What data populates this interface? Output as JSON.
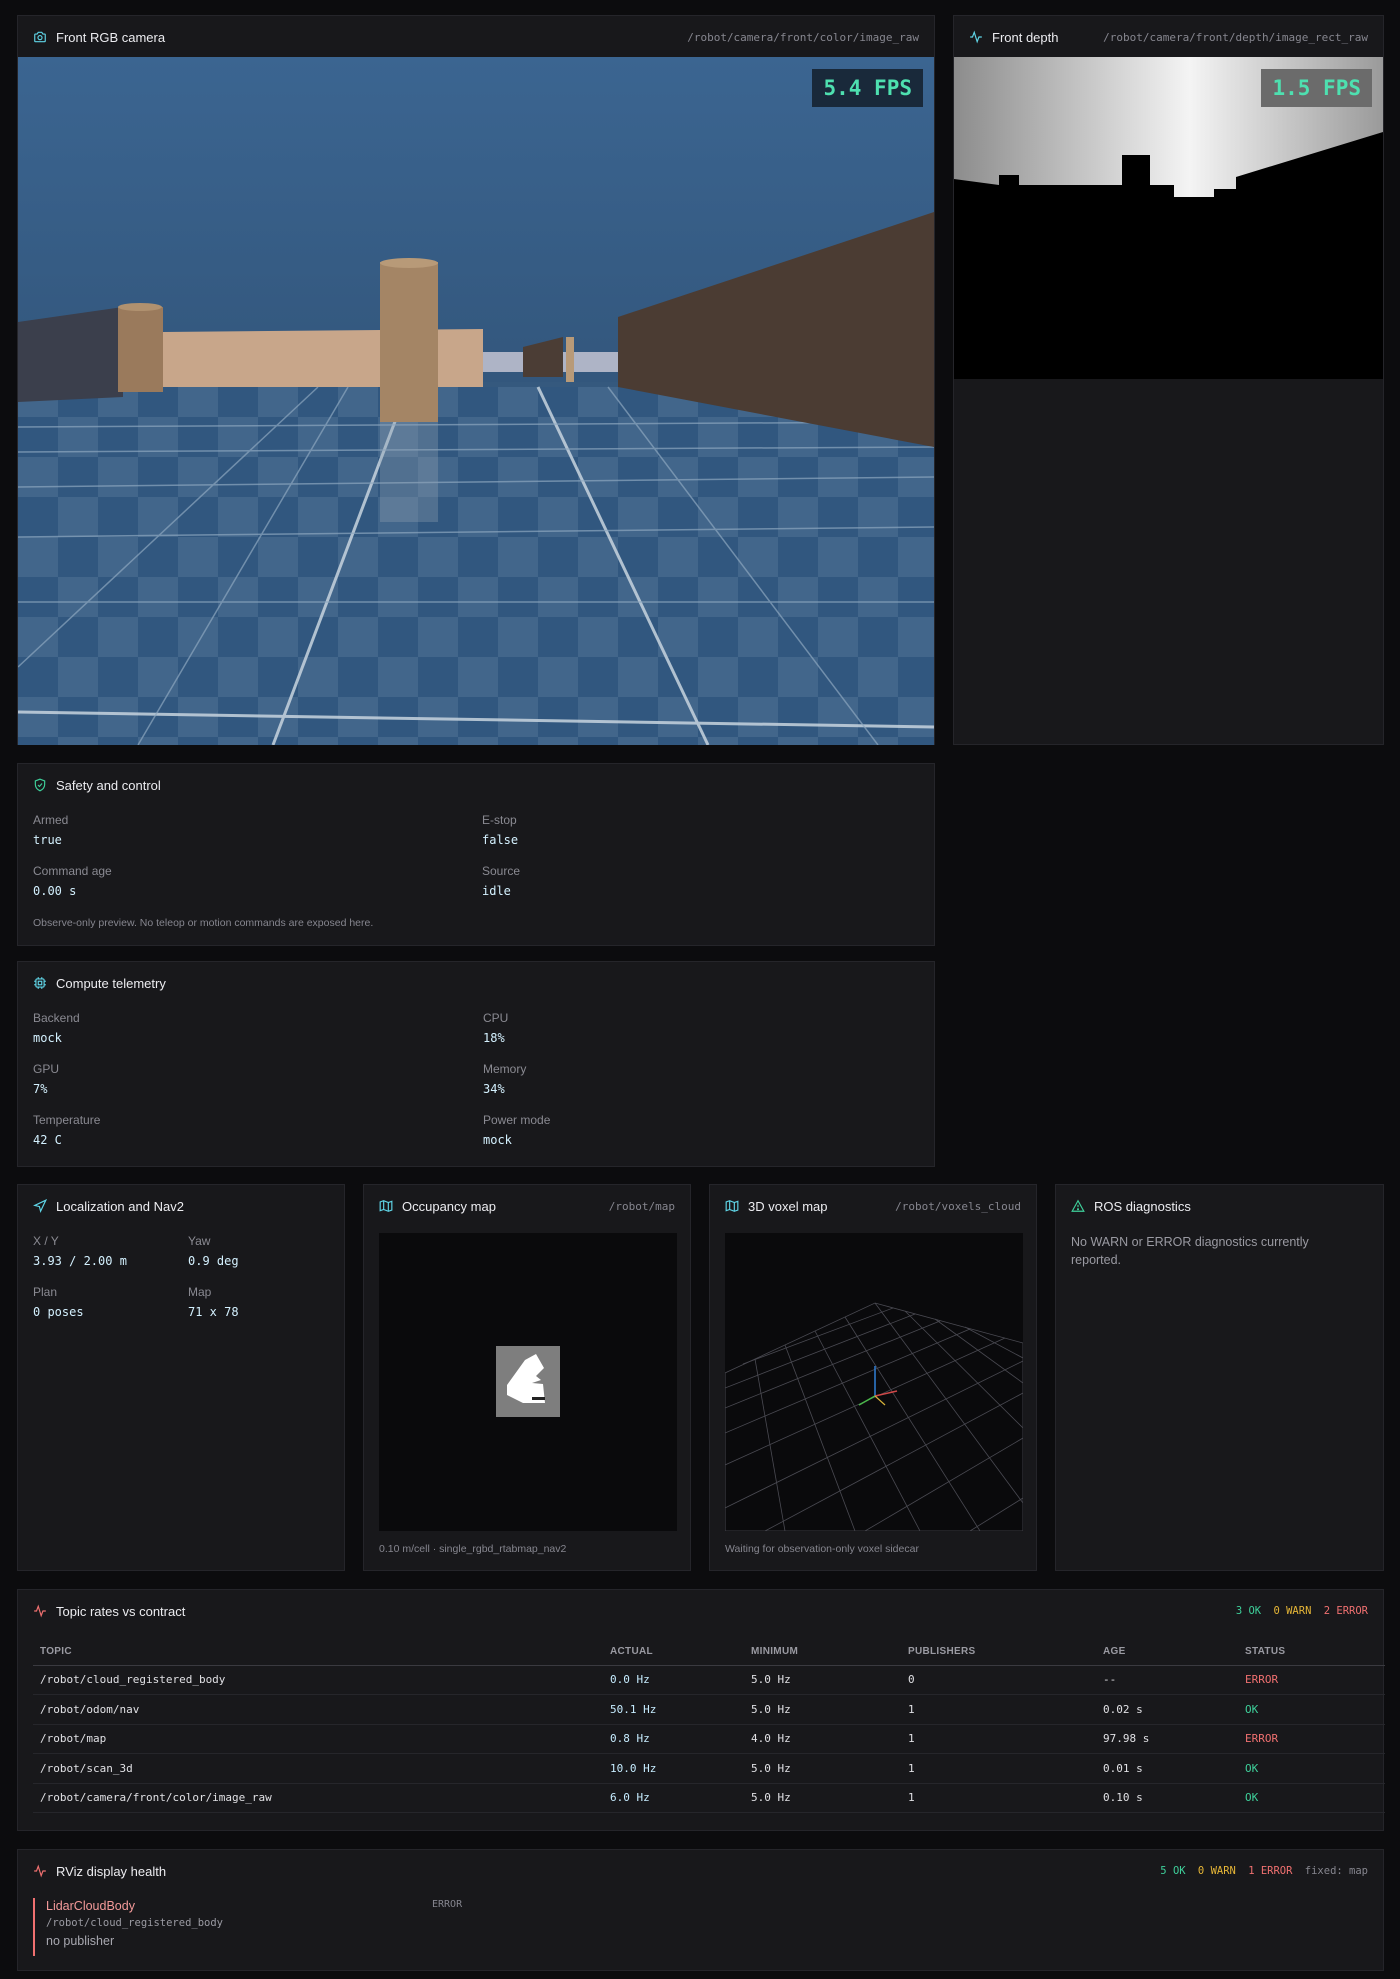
{
  "rgb_camera": {
    "title": "Front RGB camera",
    "topic": "/robot/camera/front/color/image_raw",
    "fps": "5.4 FPS"
  },
  "depth_camera": {
    "title": "Front depth",
    "topic": "/robot/camera/front/depth/image_rect_raw",
    "fps": "1.5 FPS"
  },
  "safety": {
    "title": "Safety and control",
    "fields": [
      {
        "label": "Armed",
        "value": "true"
      },
      {
        "label": "E-stop",
        "value": "false"
      },
      {
        "label": "Command age",
        "value": "0.00 s"
      },
      {
        "label": "Source",
        "value": "idle"
      }
    ],
    "note": "Observe-only preview. No teleop or motion commands are exposed here."
  },
  "compute": {
    "title": "Compute telemetry",
    "fields": [
      {
        "label": "Backend",
        "value": "mock"
      },
      {
        "label": "CPU",
        "value": "18%"
      },
      {
        "label": "GPU",
        "value": "7%"
      },
      {
        "label": "Memory",
        "value": "34%"
      },
      {
        "label": "Temperature",
        "value": "42 C"
      },
      {
        "label": "Power mode",
        "value": "mock"
      }
    ]
  },
  "localization": {
    "title": "Localization and Nav2",
    "fields": [
      {
        "label": "X / Y",
        "value": "3.93 / 2.00 m"
      },
      {
        "label": "Yaw",
        "value": "0.9 deg"
      },
      {
        "label": "Plan",
        "value": "0 poses"
      },
      {
        "label": "Map",
        "value": "71 x 78"
      }
    ]
  },
  "occupancy": {
    "title": "Occupancy map",
    "topic": "/robot/map",
    "caption": "0.10 m/cell · single_rgbd_rtabmap_nav2"
  },
  "voxel": {
    "title": "3D voxel map",
    "topic": "/robot/voxels_cloud",
    "caption": "Waiting for observation-only voxel sidecar"
  },
  "diagnostics": {
    "title": "ROS diagnostics",
    "message": "No WARN or ERROR diagnostics currently reported."
  },
  "topic_rates": {
    "title": "Topic rates vs contract",
    "summary": {
      "ok": "3 OK",
      "warn": "0 WARN",
      "error": "2 ERROR"
    },
    "columns": [
      "TOPIC",
      "ACTUAL",
      "MINIMUM",
      "PUBLISHERS",
      "AGE",
      "STATUS"
    ],
    "rows": [
      {
        "topic": "/robot/cloud_registered_body",
        "actual": "0.0 Hz",
        "minimum": "5.0 Hz",
        "publishers": "0",
        "age": "--",
        "status": "ERROR"
      },
      {
        "topic": "/robot/odom/nav",
        "actual": "50.1 Hz",
        "minimum": "5.0 Hz",
        "publishers": "1",
        "age": "0.02 s",
        "status": "OK"
      },
      {
        "topic": "/robot/map",
        "actual": "0.8 Hz",
        "minimum": "4.0 Hz",
        "publishers": "1",
        "age": "97.98 s",
        "status": "ERROR"
      },
      {
        "topic": "/robot/scan_3d",
        "actual": "10.0 Hz",
        "minimum": "5.0 Hz",
        "publishers": "1",
        "age": "0.01 s",
        "status": "OK"
      },
      {
        "topic": "/robot/camera/front/color/image_raw",
        "actual": "6.0 Hz",
        "minimum": "5.0 Hz",
        "publishers": "1",
        "age": "0.10 s",
        "status": "OK"
      }
    ]
  },
  "rviz": {
    "title": "RViz display health",
    "summary": {
      "ok": "5 OK",
      "warn": "0 WARN",
      "error": "1 ERROR",
      "fixed": "fixed: map"
    },
    "item": {
      "name": "LidarCloudBody",
      "topic": "/robot/cloud_registered_body",
      "message": "no publisher",
      "status": "ERROR"
    }
  },
  "colors": {
    "accent": "#5fd4e6",
    "ok": "#3ecf9a",
    "warn": "#e6b637",
    "error": "#f07070",
    "panel": "#18181b"
  }
}
